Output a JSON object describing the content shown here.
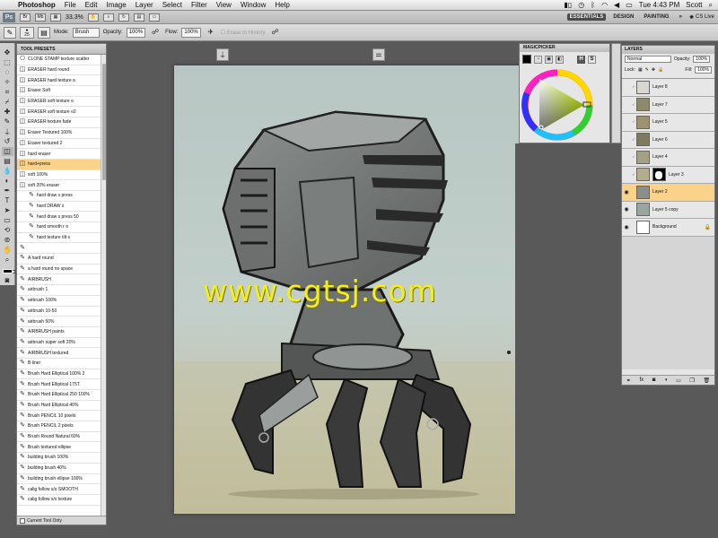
{
  "menubar": {
    "app": "Photoshop",
    "items": [
      "File",
      "Edit",
      "Image",
      "Layer",
      "Select",
      "Filter",
      "View",
      "Window",
      "Help"
    ],
    "clock": "Tue 4:43 PM",
    "user": "Scott"
  },
  "appbar": {
    "zoom": "33.3%",
    "workspaces": [
      "ESSENTIALS",
      "DESIGN",
      "PAINTING"
    ],
    "more": "»",
    "cslive": "CS Live"
  },
  "options": {
    "brush_size": "25",
    "mode_label": "Mode:",
    "mode_value": "Brush",
    "opacity_label": "Opacity:",
    "opacity_value": "100%",
    "flow_label": "Flow:",
    "flow_value": "100%",
    "history_label": "Erase to History"
  },
  "presets": {
    "title": "TOOL PRESETS",
    "items": [
      {
        "label": "CLONE STAMP texture scatter",
        "icon": "⎔"
      },
      {
        "label": "ERASER hard round",
        "icon": "◫"
      },
      {
        "label": "ERASER hard texture o",
        "icon": "◫"
      },
      {
        "label": "Eraser Soft",
        "icon": "◫"
      },
      {
        "label": "ERASER soft texture o",
        "icon": "◫"
      },
      {
        "label": "ERASER soft texture o2",
        "icon": "◫"
      },
      {
        "label": "ERASER texture fade",
        "icon": "◫"
      },
      {
        "label": "Eraser Textured 100%",
        "icon": "◫"
      },
      {
        "label": "Eraser textured 2",
        "icon": "◫"
      },
      {
        "label": "hard eraser",
        "icon": "◫"
      },
      {
        "label": "hard+press",
        "icon": "◫"
      },
      {
        "label": "soft 100%",
        "icon": "◫"
      },
      {
        "label": "soft 20% eraser",
        "icon": "◫"
      },
      {
        "label": "hard draw s press",
        "icon": "✎"
      },
      {
        "label": "hard DRAW s",
        "icon": "✎"
      },
      {
        "label": "hard draw s press 50",
        "icon": "✎"
      },
      {
        "label": "hard smooth r o",
        "icon": "✎"
      },
      {
        "label": "hard texture tilt s",
        "icon": "✎"
      },
      {
        "label": "",
        "icon": "✎"
      },
      {
        "label": "A hard round",
        "icon": "✎"
      },
      {
        "label": "a hard round no space",
        "icon": "✎"
      },
      {
        "label": "AIRBRUSH",
        "icon": "✎"
      },
      {
        "label": "airbrush 1",
        "icon": "✎"
      },
      {
        "label": "airbrush 100%",
        "icon": "✎"
      },
      {
        "label": "airbrush 10-50",
        "icon": "✎"
      },
      {
        "label": "airbrush 50%",
        "icon": "✎"
      },
      {
        "label": "AIRBRUSH paints",
        "icon": "✎"
      },
      {
        "label": "airbrush super soft 20%",
        "icon": "✎"
      },
      {
        "label": "AIRBRUSH textured",
        "icon": "✎"
      },
      {
        "label": "B liner",
        "icon": "✎"
      },
      {
        "label": "Brush Hard Elliptical 100% 2",
        "icon": "✎"
      },
      {
        "label": "Brush Hard Elliptical 175T",
        "icon": "✎"
      },
      {
        "label": "Brush Hard Elliptical 250 100%",
        "icon": "✎"
      },
      {
        "label": "Brush Hard Elliptical 40%",
        "icon": "✎"
      },
      {
        "label": "Brush PENCIL 10 pixels",
        "icon": "✎"
      },
      {
        "label": "Brush PENCIL 2 pixels",
        "icon": "✎"
      },
      {
        "label": "Brush Round Natural 60%",
        "icon": "✎"
      },
      {
        "label": "Brush textured ellipse",
        "icon": "✎"
      },
      {
        "label": "building brush 100%",
        "icon": "✎"
      },
      {
        "label": "building brush 40%",
        "icon": "✎"
      },
      {
        "label": "building brush ellipse 100%",
        "icon": "✎"
      },
      {
        "label": "calig follow s/o SMOOTH",
        "icon": "✎"
      },
      {
        "label": "calig follow s/o texture",
        "icon": "✎"
      }
    ],
    "current_tool_only": "Current Tool Only"
  },
  "canvas": {
    "watermark": "www.cgtsj.com"
  },
  "magicpicker": {
    "title": "MAGICPICKER",
    "h": "H",
    "s": "S"
  },
  "layers": {
    "title": "LAYERS",
    "blend": "Normal",
    "opacity_label": "Opacity:",
    "opacity": "100%",
    "lock_label": "Lock:",
    "fill_label": "Fill:",
    "fill": "100%",
    "items": [
      {
        "name": "Layer 8",
        "visible": false,
        "thumb": "#d8d8d0",
        "mask": false,
        "active": false
      },
      {
        "name": "Layer 7",
        "visible": false,
        "thumb": "#8c8a6a",
        "mask": false,
        "active": false
      },
      {
        "name": "Layer 5",
        "visible": false,
        "thumb": "#9d9270",
        "mask": false,
        "active": false
      },
      {
        "name": "Layer 6",
        "visible": false,
        "thumb": "#7e7a5e",
        "mask": false,
        "active": false
      },
      {
        "name": "Layer 4",
        "visible": false,
        "thumb": "#a3a184",
        "mask": false,
        "active": false
      },
      {
        "name": "Layer 3",
        "visible": false,
        "thumb": "#b3ad90",
        "mask": true,
        "active": false
      },
      {
        "name": "Layer 2",
        "visible": true,
        "thumb": "#8a8f8c",
        "mask": false,
        "active": true
      },
      {
        "name": "Layer 5 copy",
        "visible": true,
        "thumb": "#9aa5a2",
        "mask": false,
        "active": false
      },
      {
        "name": "Background",
        "visible": true,
        "thumb": "#ffffff",
        "mask": false,
        "active": false
      }
    ],
    "colors": {
      "active": "#fbd28a"
    }
  }
}
